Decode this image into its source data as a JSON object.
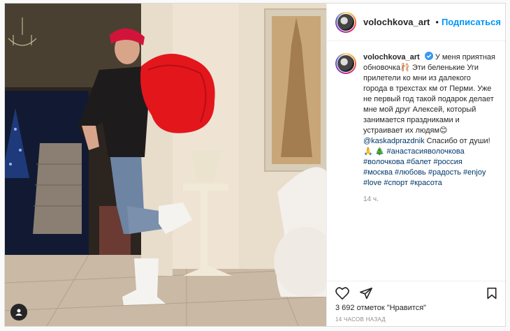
{
  "post": {
    "username": "volochkova_art",
    "follow_label": "Подписаться",
    "separator": "•",
    "caption_username": "volochkova_art",
    "caption_lines": [
      "У меня приятная",
      "обновочка",
      "Эти беленькие Уги",
      "прилетели ко мни из далекого",
      "города в трехстах км от Перми.",
      "Уже не первый год такой подарок",
      "делает мне мой друг Алексей,",
      "который занимается праздниками и",
      "устраивает их людям",
      "Спасибо от души!"
    ],
    "mention": "@kaskadprazdnik",
    "hashtags_line1": "#анастасияволочкова",
    "hashtags_line2": "#волочкова #балет #россия",
    "hashtags_line3": "#москва #любовь #радость #enjoy",
    "hashtags_line4": "#love #спорт #красота",
    "time_ago": "14 ч.",
    "likes": "3 692 отметок \"Нравится\"",
    "timestamp": "14 ЧАСОВ НАЗАД"
  },
  "icons": {
    "verified": "verified-badge-icon",
    "heart": "heart-icon",
    "share": "paper-plane-icon",
    "bookmark": "bookmark-icon",
    "user_tag": "user-tag-icon"
  },
  "colors": {
    "accent": "#0095f6",
    "link": "#00376b",
    "text": "#262626",
    "muted": "#8e8e8e",
    "border": "#dbdbdb"
  }
}
